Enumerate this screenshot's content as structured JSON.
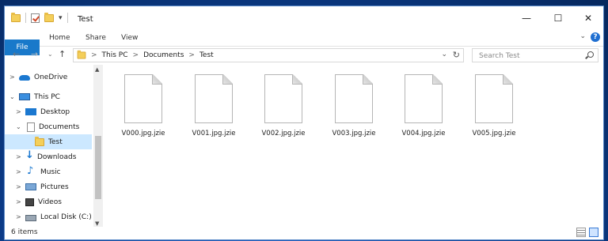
{
  "window": {
    "title": "Test",
    "qat_dropdown": "▾",
    "controls": {
      "minimize": "—",
      "maximize": "☐",
      "close": "✕"
    }
  },
  "ribbon": {
    "tabs": [
      "File",
      "Home",
      "Share",
      "View"
    ],
    "expand_glyph": "⌄",
    "help_glyph": "?"
  },
  "nav": {
    "back": "←",
    "forward": "→",
    "recent": "⌄",
    "up": "↑"
  },
  "address": {
    "crumbs": [
      "This PC",
      "Documents",
      "Test"
    ],
    "separator": ">",
    "dropdown": "⌄",
    "refresh": "↻"
  },
  "search": {
    "placeholder": "Search Test"
  },
  "sidebar": {
    "items": [
      {
        "label": "OneDrive",
        "expander": ">"
      },
      {
        "label": "This PC",
        "expander": "⌄"
      },
      {
        "label": "Desktop",
        "expander": ">"
      },
      {
        "label": "Documents",
        "expander": "⌄"
      },
      {
        "label": "Test",
        "expander": ""
      },
      {
        "label": "Downloads",
        "expander": ">"
      },
      {
        "label": "Music",
        "expander": ">"
      },
      {
        "label": "Pictures",
        "expander": ">"
      },
      {
        "label": "Videos",
        "expander": ">"
      },
      {
        "label": "Local Disk (C:)",
        "expander": ">"
      }
    ],
    "scroll_up": "▲",
    "scroll_down": "▼"
  },
  "files": [
    {
      "name": "V000.jpg.jzie"
    },
    {
      "name": "V001.jpg.jzie"
    },
    {
      "name": "V002.jpg.jzie"
    },
    {
      "name": "V003.jpg.jzie"
    },
    {
      "name": "V004.jpg.jzie"
    },
    {
      "name": "V005.jpg.jzie"
    }
  ],
  "status": {
    "item_count": "6 items"
  },
  "colors": {
    "accent": "#1979ca",
    "selection": "#cce8ff",
    "folder": "#f4cf5a"
  }
}
